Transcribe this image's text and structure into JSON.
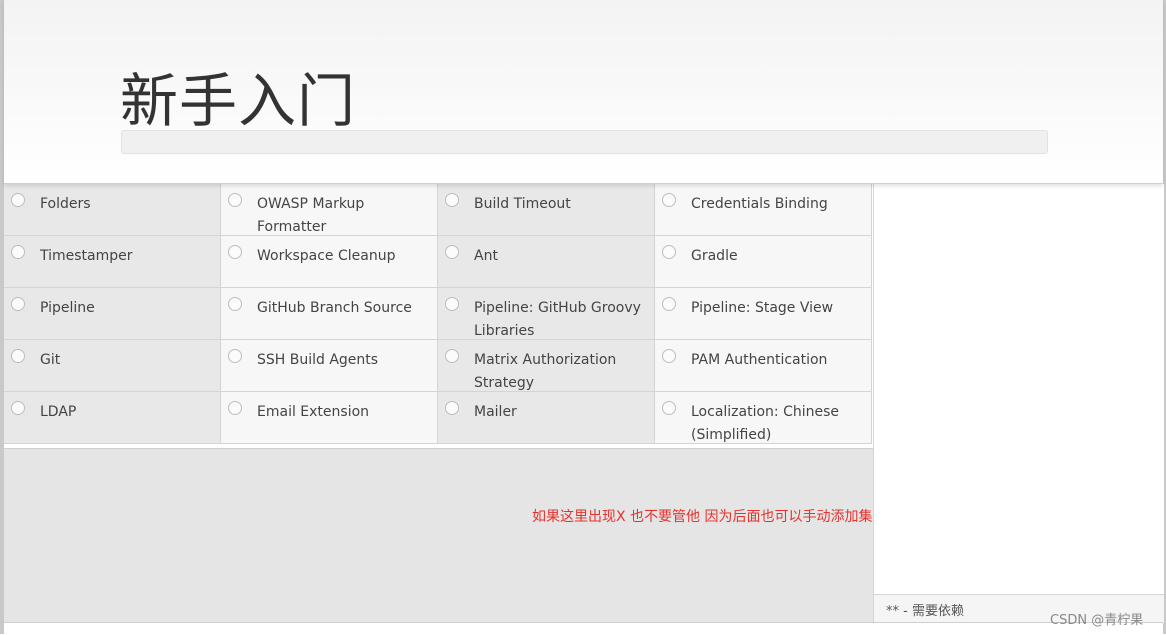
{
  "header": {
    "title": "新手入门",
    "progress": 0
  },
  "plugins": [
    {
      "label": "Folders"
    },
    {
      "label": "OWASP Markup Formatter"
    },
    {
      "label": "Build Timeout"
    },
    {
      "label": "Credentials Binding"
    },
    {
      "label": "Timestamper"
    },
    {
      "label": "Workspace Cleanup"
    },
    {
      "label": "Ant"
    },
    {
      "label": "Gradle"
    },
    {
      "label": "Pipeline"
    },
    {
      "label": "GitHub Branch Source"
    },
    {
      "label": "Pipeline: GitHub Groovy Libraries"
    },
    {
      "label": "Pipeline: Stage View"
    },
    {
      "label": "Git"
    },
    {
      "label": "SSH Build Agents"
    },
    {
      "label": "Matrix Authorization Strategy"
    },
    {
      "label": "PAM Authentication"
    },
    {
      "label": "LDAP"
    },
    {
      "label": "Email Extension"
    },
    {
      "label": "Mailer"
    },
    {
      "label": "Localization: Chinese (Simplified)"
    }
  ],
  "annotation": "如果这里出现X 也不要管他 因为后面也可以手动添加集成的软件",
  "side_panel": {
    "dependency_note": "** - 需要依赖"
  },
  "watermark": "CSDN @青柠果",
  "colors": {
    "annotation": "#e5322d",
    "cell_light": "#f7f7f7",
    "cell_shaded": "#e8e8e8"
  }
}
